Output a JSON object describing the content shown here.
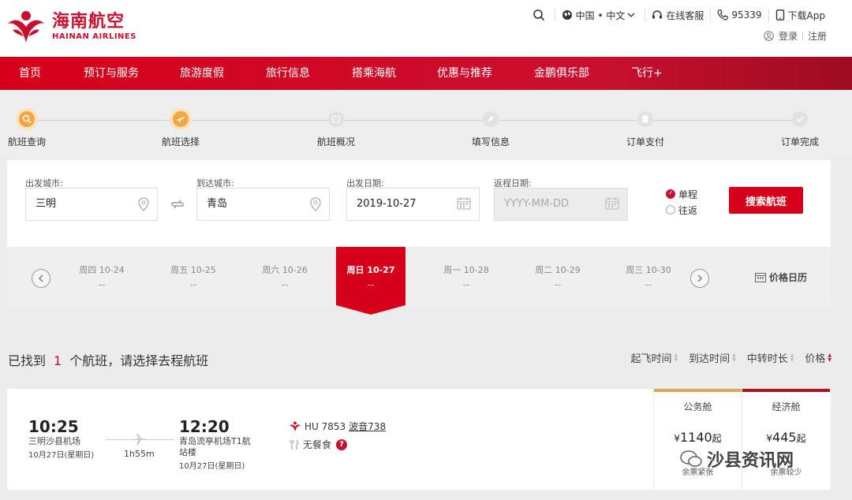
{
  "brand": {
    "name_cn": "海南航空",
    "name_en": "HAINAN AIRLINES",
    "primary": "#c8102e"
  },
  "top_util": {
    "region": "中国 • 中文",
    "support": "在线客服",
    "phone": "95339",
    "app": "下载App",
    "login": "登录",
    "register": "注册"
  },
  "nav": {
    "items": [
      "首页",
      "预订与服务",
      "旅游度假",
      "旅行信息",
      "搭乘海航",
      "优惠与推荐",
      "金鹏俱乐部",
      "飞行+"
    ]
  },
  "steps": {
    "items": [
      "航班查询",
      "航班选择",
      "航班概况",
      "填写信息",
      "订单支付",
      "订单完成"
    ]
  },
  "search": {
    "from_label": "出发城市:",
    "from_value": "三明",
    "to_label": "到达城市:",
    "to_value": "青岛",
    "depart_label": "出发日期:",
    "depart_value": "2019-10-27",
    "return_label": "返程日期:",
    "return_placeholder": "YYYY-MM-DD",
    "trip_oneway": "单程",
    "trip_roundtrip": "往返",
    "search_button": "搜索航班"
  },
  "date_strip": {
    "days": [
      {
        "label": "周四  10-24",
        "price": "--"
      },
      {
        "label": "周五  10-25",
        "price": "--"
      },
      {
        "label": "周六  10-26",
        "price": "--"
      },
      {
        "label": "周日  10-27",
        "price": "--"
      },
      {
        "label": "周一  10-28",
        "price": "--"
      },
      {
        "label": "周二  10-29",
        "price": "--"
      },
      {
        "label": "周三  10-30",
        "price": "--"
      }
    ],
    "price_calendar": "价格日历"
  },
  "results": {
    "prefix": "已找到",
    "count": "1",
    "suffix": "个航班，请选择去程航班",
    "sorts": [
      "起飞时间",
      "到达时间",
      "中转时长",
      "价格"
    ]
  },
  "flight": {
    "dep_time": "10:25",
    "dep_airport": "三明沙县机场",
    "dep_date": "10月27日(星期日)",
    "duration": "1h55m",
    "arr_time": "12:20",
    "arr_airport_line1": "青岛流亭机场T1航",
    "arr_airport_line2": "站楼",
    "arr_date": "10月27日(星期日)",
    "flight_no": "HU 7853",
    "aircraft": "波音738",
    "meal": "无餐食",
    "business": {
      "name": "公务舱",
      "price": "1140",
      "suffix": "起",
      "currency": "¥",
      "avail": "余票紧张",
      "color": "#d9a65b"
    },
    "economy": {
      "name": "经济舱",
      "price": "445",
      "suffix": "起",
      "currency": "¥",
      "avail": "余票较少",
      "color": "#b0101f"
    }
  },
  "watermark": {
    "text": "沙县资讯网"
  }
}
